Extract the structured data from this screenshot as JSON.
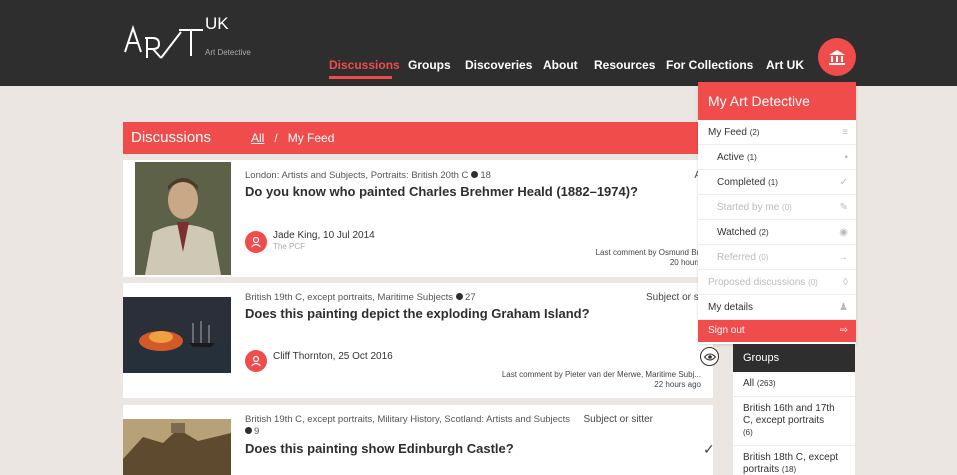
{
  "brand": {
    "logo_text": "A R T",
    "logo_uk": "UK",
    "logo_sub": "Art Detective"
  },
  "nav": {
    "items": [
      {
        "label": "Discussions",
        "active": true
      },
      {
        "label": "Groups"
      },
      {
        "label": "Discoveries"
      },
      {
        "label": "About"
      },
      {
        "label": "Resources"
      },
      {
        "label": "For Collections"
      },
      {
        "label": "Art UK"
      }
    ]
  },
  "discussions": {
    "title": "Discussions",
    "filter_all": "All",
    "filter_sep": "/",
    "filter_feed": "My Feed",
    "cards": [
      {
        "tags": "London: Artists and Subjects, Portraits: British 20th C",
        "count": "18",
        "right": "A",
        "title": "Do you know who painted Charles Brehmer Heald (1882–1974)?",
        "author": "Jade King, 10 Jul 2014",
        "org": "The PCF",
        "last": "Last comment by Osmund Bu",
        "ago": "20 hours"
      },
      {
        "tags": "British 19th C, except portraits, Maritime Subjects",
        "count": "27",
        "right": "Subject or si",
        "title": "Does this painting depict the exploding Graham Island?",
        "author": "Cliff Thornton, 25 Oct 2016",
        "last": "Last comment by Pieter van der Merwe, Maritime Subj...",
        "ago": "22 hours ago"
      },
      {
        "tags": "British 19th C, except portraits, Military History, Scotland: Artists and Subjects",
        "count": "9",
        "right": "Subject or sitter",
        "title": "Does this painting show Edinburgh Castle?"
      }
    ]
  },
  "my_art_detective": {
    "title": "My Art Detective",
    "items": [
      {
        "label": "My Feed",
        "count": "(2)",
        "icon": "menu-icon",
        "glyph": "≡",
        "level": "top"
      },
      {
        "label": "Active",
        "count": "(1)",
        "icon": "chat-icon",
        "glyph": "▪",
        "level": "sub"
      },
      {
        "label": "Completed",
        "count": "(1)",
        "icon": "check-icon",
        "glyph": "✓",
        "level": "sub"
      },
      {
        "label": "Started by me",
        "count": "(0)",
        "icon": "pencil-icon",
        "glyph": "✎",
        "level": "sub",
        "muted": true
      },
      {
        "label": "Watched",
        "count": "(2)",
        "icon": "eye-icon",
        "glyph": "◉",
        "level": "sub"
      },
      {
        "label": "Referred",
        "count": "(0)",
        "icon": "arrow-icon",
        "glyph": "→",
        "level": "sub",
        "muted": true
      },
      {
        "label": "Proposed discussions",
        "count": "(0)",
        "icon": "bulb-icon",
        "glyph": "◊",
        "level": "top",
        "muted": true
      },
      {
        "label": "My details",
        "count": "",
        "icon": "user-icon",
        "glyph": "♟",
        "level": "top"
      }
    ],
    "sign_out": "Sign out"
  },
  "groups": {
    "title": "Groups",
    "items": [
      {
        "label": "All",
        "count": "(263)"
      },
      {
        "label": "British 16th and 17th C, except portraits",
        "count": "(6)"
      },
      {
        "label": "British 18th C, except portraits",
        "count": "(18)"
      }
    ]
  },
  "colors": {
    "accent": "#f04c4c",
    "dark": "#2e2e2e",
    "background": "#ebe6e1"
  }
}
